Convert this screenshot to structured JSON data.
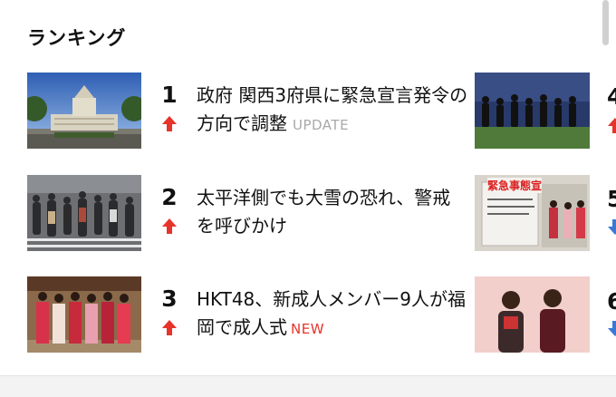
{
  "section": {
    "title": "ランキング"
  },
  "items": [
    {
      "rank": "1",
      "trend": "up",
      "title": "政府 関西3府県に緊急宣言発令の方向で調整",
      "tag": "UPDATE",
      "image": "diet-building-photo"
    },
    {
      "rank": "2",
      "trend": "up",
      "title": "太平洋側でも大雪の恐れ、警戒を呼びかけ",
      "tag": "",
      "image": "crowd-crosswalk-photo"
    },
    {
      "rank": "3",
      "trend": "up",
      "title": "HKT48、新成人メンバー9人が福岡で成人式",
      "tag": "NEW",
      "image": "kimono-group-photo"
    }
  ],
  "right_items": [
    {
      "rank": "4",
      "trend": "up",
      "image": "soccer-team-photo"
    },
    {
      "rank": "5",
      "trend": "down",
      "image": "emergency-notice-photo",
      "sign_text": "緊急事態宣"
    },
    {
      "rank": "6",
      "trend": "down",
      "image": "two-women-red-photo"
    }
  ],
  "colors": {
    "up": "#e6342b",
    "down": "#3a78d6",
    "new": "#e6342b",
    "update": "#a9a9a9"
  }
}
